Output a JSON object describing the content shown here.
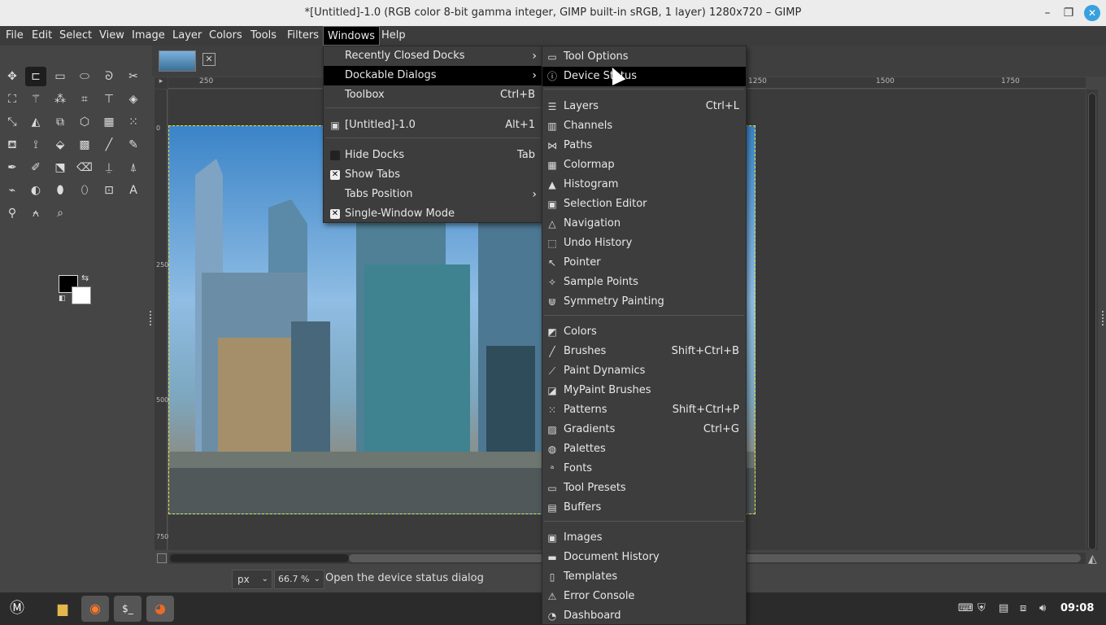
{
  "window": {
    "title": "*[Untitled]-1.0 (RGB color 8-bit gamma integer, GIMP built-in sRGB, 1 layer) 1280x720 – GIMP",
    "minimize_icon": "minimize-icon",
    "maximize_icon": "maximize-icon",
    "close_icon": "close-icon"
  },
  "menubar": [
    "File",
    "Edit",
    "Select",
    "View",
    "Image",
    "Layer",
    "Colors",
    "Tools",
    "Filters",
    "Windows",
    "Help"
  ],
  "windows_menu": {
    "items": [
      {
        "label": "Recently Closed Docks",
        "shortcut": "",
        "submenu": true
      },
      {
        "label": "Dockable Dialogs",
        "shortcut": "",
        "submenu": true,
        "highlighted": true
      },
      {
        "label": "Toolbox",
        "shortcut": "Ctrl+B"
      },
      {
        "label": "[Untitled]-1.0",
        "shortcut": "Alt+1"
      },
      {
        "label": "Hide Docks",
        "shortcut": "Tab",
        "checked": false
      },
      {
        "label": "Show Tabs",
        "shortcut": "",
        "checked": true
      },
      {
        "label": "Tabs Position",
        "shortcut": "",
        "submenu": true
      },
      {
        "label": "Single-Window Mode",
        "shortcut": "",
        "checked": true
      }
    ]
  },
  "dockable_menu": {
    "items": [
      {
        "label": "Tool Options",
        "shortcut": "",
        "icon": "tool-options-icon"
      },
      {
        "label": "Device Status",
        "shortcut": "",
        "icon": "device-status-icon",
        "highlighted": true
      },
      {
        "label": "Layers",
        "shortcut": "Ctrl+L",
        "icon": "layers-icon"
      },
      {
        "label": "Channels",
        "shortcut": "",
        "icon": "channels-icon"
      },
      {
        "label": "Paths",
        "shortcut": "",
        "icon": "paths-icon"
      },
      {
        "label": "Colormap",
        "shortcut": "",
        "icon": "colormap-icon"
      },
      {
        "label": "Histogram",
        "shortcut": "",
        "icon": "histogram-icon"
      },
      {
        "label": "Selection Editor",
        "shortcut": "",
        "icon": "selection-editor-icon"
      },
      {
        "label": "Navigation",
        "shortcut": "",
        "icon": "navigation-icon"
      },
      {
        "label": "Undo History",
        "shortcut": "",
        "icon": "undo-history-icon"
      },
      {
        "label": "Pointer",
        "shortcut": "",
        "icon": "pointer-icon"
      },
      {
        "label": "Sample Points",
        "shortcut": "",
        "icon": "sample-points-icon"
      },
      {
        "label": "Symmetry Painting",
        "shortcut": "",
        "icon": "symmetry-icon"
      },
      {
        "label": "Colors",
        "shortcut": "",
        "icon": "colors-icon"
      },
      {
        "label": "Brushes",
        "shortcut": "Shift+Ctrl+B",
        "icon": "brushes-icon"
      },
      {
        "label": "Paint Dynamics",
        "shortcut": "",
        "icon": "paint-dynamics-icon"
      },
      {
        "label": "MyPaint Brushes",
        "shortcut": "",
        "icon": "mypaint-brushes-icon"
      },
      {
        "label": "Patterns",
        "shortcut": "Shift+Ctrl+P",
        "icon": "patterns-icon"
      },
      {
        "label": "Gradients",
        "shortcut": "Ctrl+G",
        "icon": "gradients-icon"
      },
      {
        "label": "Palettes",
        "shortcut": "",
        "icon": "palettes-icon"
      },
      {
        "label": "Fonts",
        "shortcut": "",
        "icon": "fonts-icon"
      },
      {
        "label": "Tool Presets",
        "shortcut": "",
        "icon": "tool-presets-icon"
      },
      {
        "label": "Buffers",
        "shortcut": "",
        "icon": "buffers-icon"
      },
      {
        "label": "Images",
        "shortcut": "",
        "icon": "images-icon"
      },
      {
        "label": "Document History",
        "shortcut": "",
        "icon": "document-history-icon"
      },
      {
        "label": "Templates",
        "shortcut": "",
        "icon": "templates-icon"
      },
      {
        "label": "Error Console",
        "shortcut": "",
        "icon": "error-console-icon"
      },
      {
        "label": "Dashboard",
        "shortcut": "",
        "icon": "dashboard-icon"
      }
    ]
  },
  "rulers": {
    "h_labels": [
      "250",
      "1250",
      "1500",
      "1750"
    ],
    "v_labels": [
      "0",
      "250",
      "500",
      "750"
    ]
  },
  "status": {
    "unit": "px",
    "zoom": "66.7 %",
    "message": "Open the device status dialog"
  },
  "taskbar": {
    "clock": "09:08"
  },
  "colors": {
    "menu_bg": "#3d3d3d",
    "highlight": "#000000",
    "accent": "#39a0e0"
  }
}
